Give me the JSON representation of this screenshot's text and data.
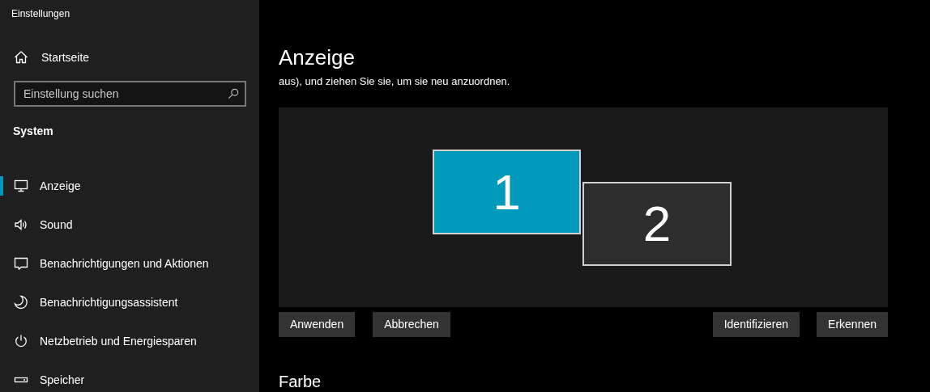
{
  "window": {
    "title": "Einstellungen"
  },
  "sidebar": {
    "home": "Startseite",
    "search": {
      "placeholder": "Einstellung suchen"
    },
    "section": "System",
    "items": [
      {
        "label": "Anzeige",
        "selected": true
      },
      {
        "label": "Sound",
        "selected": false
      },
      {
        "label": "Benachrichtigungen und Aktionen",
        "selected": false
      },
      {
        "label": "Benachrichtigungsassistent",
        "selected": false
      },
      {
        "label": "Netzbetrieb und Energiesparen",
        "selected": false
      },
      {
        "label": "Speicher",
        "selected": false
      }
    ]
  },
  "main": {
    "title": "Anzeige",
    "description": "aus), und ziehen Sie sie, um sie neu anzuordnen.",
    "monitors": [
      {
        "label": "1",
        "selected": true
      },
      {
        "label": "2",
        "selected": false
      }
    ],
    "buttons_left": [
      "Anwenden",
      "Abbrechen"
    ],
    "buttons_right": [
      "Identifizieren",
      "Erkennen"
    ],
    "next_section": "Farbe"
  }
}
